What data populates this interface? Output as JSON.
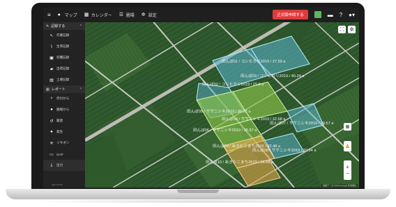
{
  "topbar": {
    "nav": [
      {
        "label": "マップ",
        "icon": "pin-icon"
      },
      {
        "label": "カレンダー",
        "icon": "calendar-icon"
      },
      {
        "label": "圃場",
        "icon": "list-icon"
      },
      {
        "label": "設定",
        "icon": "gear-icon"
      }
    ],
    "pro_button": "正式版申請する"
  },
  "sidebar": {
    "record_section": "記録する",
    "record_items": [
      "作業記録",
      "生育記録",
      "収穫記録",
      "出荷記録",
      "土壌記録"
    ],
    "report_section": "レポート",
    "report_items": [
      "作付から",
      "圃場から",
      "履歴",
      "発生",
      "リサポン",
      "GAP"
    ],
    "output": "出力",
    "footer": "agri-note"
  },
  "map": {
    "fields": [
      {
        "label": "田んぼ01 / コシヒカリ2019 / 27.59 a"
      },
      {
        "label": "田んぼ03 / コシヒカリ2019 / 40.24 a"
      },
      {
        "label": "田んぼ02 / コシヒカリ2019 / 29.8 a"
      },
      {
        "label": "田んぼ05 / ササニシキ2019 / 30.22 a"
      },
      {
        "label": "田んぼ04 / ササニシキ2019 / 32.68 a"
      },
      {
        "label": "田んぼ07 / ササニシキ2019 / 29.57 a"
      },
      {
        "label": "田んぼ06 / ササニシキ2019 / 35.87 a"
      },
      {
        "label": "田んぼ09 / あきたこまち2019 / 32.48 a"
      },
      {
        "label": "田んぼ08 / ササニシキ2019 / 10.54 a"
      },
      {
        "label": "田んぼ10 / あきたこまち2019 / 16.68 a"
      }
    ],
    "attribution": "地図データ ©2019 Google  利用規約"
  },
  "colors": {
    "highlight_blue": "#5bb8d4",
    "highlight_green": "#8bc34a",
    "highlight_orange": "#e2a64a",
    "accent_red": "#e03b3b"
  }
}
